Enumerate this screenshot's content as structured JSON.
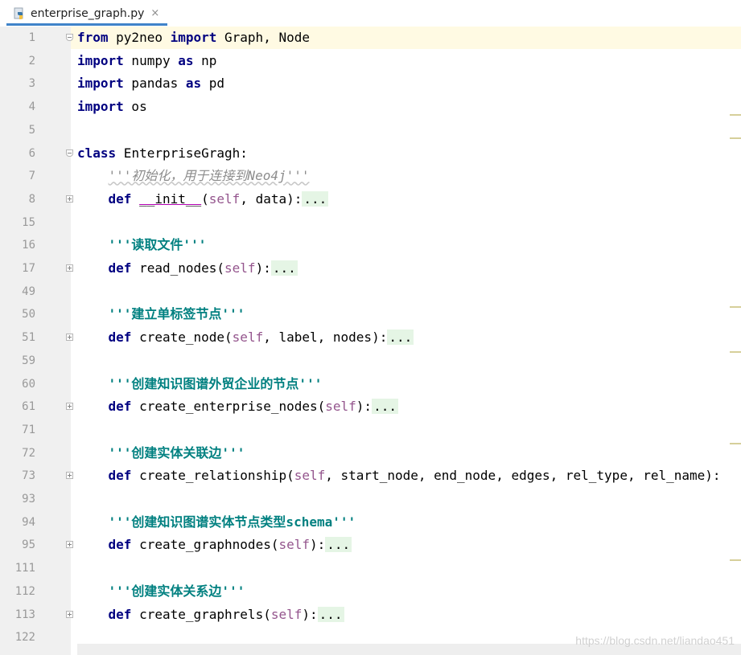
{
  "tab": {
    "filename": "enterprise_graph.py",
    "close_glyph": "×"
  },
  "lines": [
    {
      "num": "1",
      "text": "from py2neo import Graph, Node"
    },
    {
      "num": "2",
      "text": "import numpy as np"
    },
    {
      "num": "3",
      "text": "import pandas as pd"
    },
    {
      "num": "4",
      "text": "import os"
    },
    {
      "num": "5",
      "text": ""
    },
    {
      "num": "6",
      "text": "class EnterpriseGragh:"
    },
    {
      "num": "7",
      "text": "    '''初始化，用于连接到Neo4j'''"
    },
    {
      "num": "8",
      "text": "    def __init__(self, data):..."
    },
    {
      "num": "15",
      "text": ""
    },
    {
      "num": "16",
      "text": "    '''读取文件'''"
    },
    {
      "num": "17",
      "text": "    def read_nodes(self):..."
    },
    {
      "num": "49",
      "text": ""
    },
    {
      "num": "50",
      "text": "    '''建立单标签节点'''"
    },
    {
      "num": "51",
      "text": "    def create_node(self, label, nodes):..."
    },
    {
      "num": "59",
      "text": ""
    },
    {
      "num": "60",
      "text": "    '''创建知识图谱外贸企业的节点'''"
    },
    {
      "num": "61",
      "text": "    def create_enterprise_nodes(self):..."
    },
    {
      "num": "71",
      "text": ""
    },
    {
      "num": "72",
      "text": "    '''创建实体关联边'''"
    },
    {
      "num": "73",
      "text": "    def create_relationship(self, start_node, end_node, edges, rel_type, rel_name):"
    },
    {
      "num": "93",
      "text": ""
    },
    {
      "num": "94",
      "text": "    '''创建知识图谱实体节点类型schema'''"
    },
    {
      "num": "95",
      "text": "    def create_graphnodes(self):..."
    },
    {
      "num": "111",
      "text": ""
    },
    {
      "num": "112",
      "text": "    '''创建实体关系边'''"
    },
    {
      "num": "113",
      "text": "    def create_graphrels(self):..."
    },
    {
      "num": "122",
      "text": ""
    }
  ],
  "watermark": "https://blog.csdn.net/liandao451",
  "colors": {
    "keyword": "#000080",
    "self": "#94558d",
    "docstring": "#008080",
    "comment_italic": "#8c8c8c",
    "current_line": "#fffae3",
    "gutter": "#f0f0f0",
    "tab_underline": "#4083c9"
  }
}
